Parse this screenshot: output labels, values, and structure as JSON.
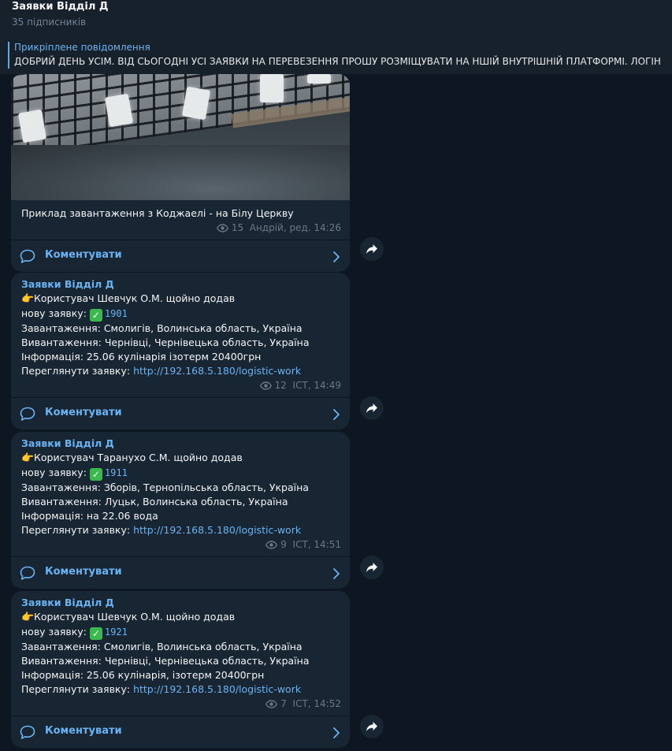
{
  "header": {
    "title": "Заявки Відділ Д",
    "subscribers": "35 підписників"
  },
  "pinned": {
    "label": "Прикріплене повідомлення",
    "text": "ДОБРИЙ ДЕНЬ УСІМ. ВІД СЬОГОДНІ УСІ ЗАЯВКИ НА ПЕРЕВЕЗЕННЯ ПРОШУ РОЗМІЩУВАТИ НА НШІЙ ВНУТРІШНІЙ ПЛАТФОРМІ.  ЛОГІН"
  },
  "comments_label": "Коментувати",
  "posts": [
    {
      "caption": "Приклад завантаження з Коджаелі - на Білу Церкву",
      "views": "15",
      "meta": "Андрій, ред. 14:26"
    },
    {
      "sender": "Заявки Відділ Д",
      "line1": "Користувач Шевчук О.М. щойно додав",
      "line2_prefix": "нову заявку: ",
      "number": "1901",
      "loading": "Завантаження: Смолигів, Волинська область, Україна",
      "unloading": "Вивантаження: Чернівці, Чернівецька область, Україна",
      "info": "Інформація: 25.06 кулінарія ізотерм 20400грн",
      "view_prefix": "Переглянути заявку: ",
      "link": "http://192.168.5.180/logistic-work",
      "views": "12",
      "meta": "ICT, 14:49"
    },
    {
      "sender": "Заявки Відділ Д",
      "line1": "Користувач Таранухо С.М. щойно додав",
      "line2_prefix": "нову заявку: ",
      "number": "1911",
      "loading": "Завантаження: Зборів, Тернопільська область, Україна",
      "unloading": "Вивантаження: Луцьк, Волинська область, Україна",
      "info": "Інформація: на 22.06 вода",
      "view_prefix": "Переглянути заявку: ",
      "link": "http://192.168.5.180/logistic-work",
      "views": "9",
      "meta": "ICT, 14:51"
    },
    {
      "sender": "Заявки Відділ Д",
      "line1": "Користувач Шевчук О.М. щойно додав",
      "line2_prefix": "нову заявку: ",
      "number": "1921",
      "loading": "Завантаження: Смолигів, Волинська область, Україна",
      "unloading": "Вивантаження: Чернівці, Чернівецька область, Україна",
      "info": "Інформація: 25.06 кулінарія, ізотерм 20400грн",
      "view_prefix": "Переглянути заявку: ",
      "link": "http://192.168.5.180/logistic-work",
      "views": "7",
      "meta": "ICT, 14:52"
    }
  ],
  "colors": {
    "background": "#0e1621",
    "bubble": "#182533",
    "accent": "#6ab3f3",
    "check": "#3cb94e"
  },
  "icons": [
    "eye-icon",
    "comment-icon",
    "chevron-right-icon",
    "share-icon",
    "check-mark-icon",
    "pointing-hand-icon"
  ]
}
